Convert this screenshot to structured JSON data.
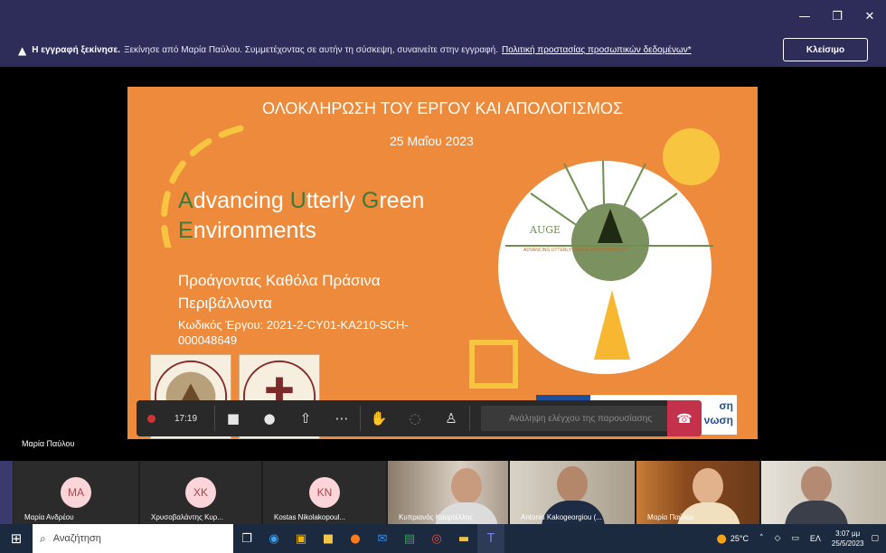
{
  "window": {
    "minimize": "—",
    "restore": "❐",
    "close": "✕"
  },
  "banner": {
    "bold": "Η εγγραφή ξεκίνησε.",
    "text": "Ξεκίνησε από Μαρία Παύλου. Συμμετέχοντας σε αυτήν τη σύσκεψη, συναινείτε στην εγγραφή.",
    "link": "Πολιτική προστασίας προσωπικών δεδομένων*",
    "close_label": "Κλείσιμο"
  },
  "slide": {
    "title": "ΟΛΟΚΛΗΡΩΣΗ ΤΟΥ ΕΡΓΟΥ ΚΑΙ ΑΠΟΛΟΓΙΣΜΟΣ",
    "date": "25 Μαΐου 2023",
    "eng_a": "A",
    "eng_1": "dvancing ",
    "eng_u": "U",
    "eng_2": "tterly ",
    "eng_g": "G",
    "eng_3": "reen",
    "eng_e": "E",
    "eng_4": "nvironments",
    "greek_1": "Προάγοντας Καθόλα Πράσινα",
    "greek_2": "Περιβάλλοντα",
    "code_1": "Κωδικός Έργου: 2021-2-CY01-KA210-SCH-",
    "code_2": "000048649",
    "logo_name": "AUGE",
    "logo_sub": "ADVANCING UTTERLY GREEN ENVIRONMENTS",
    "partner_1": "ση",
    "partner_2": "νωση"
  },
  "presenter": "Μαρία Παύλου",
  "toolbar": {
    "timer": "17:19",
    "take_control": "Ανάληψη ελέγχου της παρουσίασης"
  },
  "participants": [
    {
      "initials": "MA",
      "name": "Μαρία Ανδρέου"
    },
    {
      "initials": "ΧΚ",
      "name": "Χρυσοβαλάντης Κυρ..."
    },
    {
      "initials": "KN",
      "name": "Kostas Nikolakopoul..."
    },
    {
      "name": "Κυπριανός Κουρτέλλης"
    },
    {
      "name": "Antonis Kakogeorgiou (..."
    },
    {
      "name": "Μαρία Παύλου"
    },
    {
      "name": ""
    }
  ],
  "taskbar": {
    "search": "Αναζήτηση",
    "temp": "25°C",
    "lang": "ΕΛ",
    "time": "3:07 μμ",
    "date": "25/5/2023",
    "mail_badge": "11"
  }
}
